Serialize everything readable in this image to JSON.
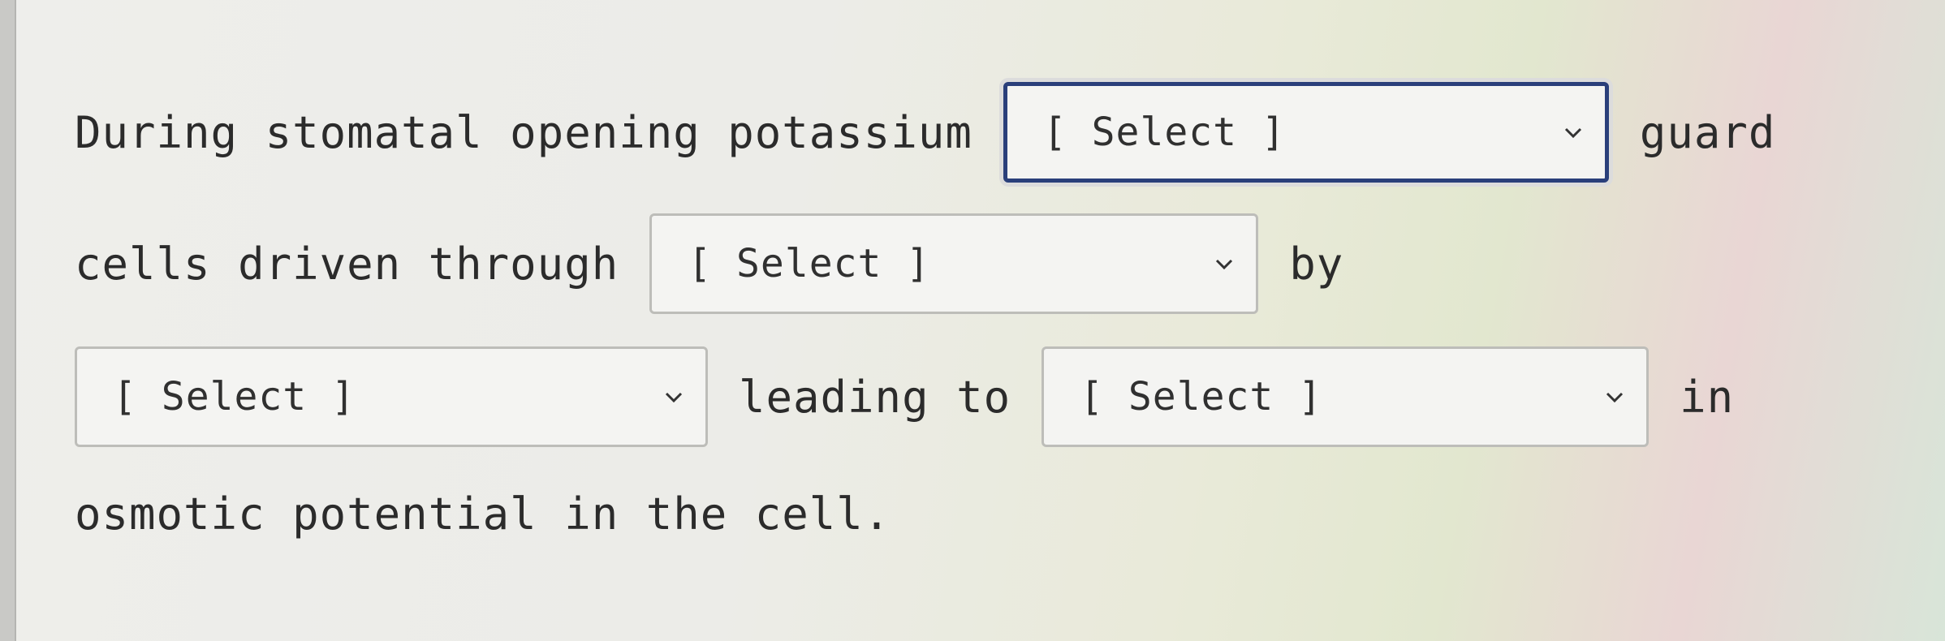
{
  "question": {
    "line1_text": "During stomatal opening potassium",
    "line1_after": "guard",
    "line2_text": "cells driven through",
    "line2_after": "by",
    "line3_mid": "leading to",
    "line3_after": "in",
    "line4_text": "osmotic potential in the cell."
  },
  "dropdowns": [
    {
      "selected": "[ Select ]"
    },
    {
      "selected": "[ Select ]"
    },
    {
      "selected": "[ Select ]"
    },
    {
      "selected": "[ Select ]"
    }
  ],
  "icons": {
    "dropdown_arrow": "chevron-down-icon"
  },
  "colors": {
    "focus_border": "#2a3f7a",
    "text": "#2b2b2b"
  }
}
